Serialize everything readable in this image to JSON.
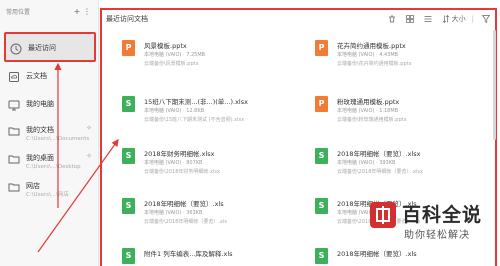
{
  "sidebar": {
    "header_title": "常用位置",
    "add_label": "+",
    "more_label": "⋮",
    "items": [
      {
        "label": "最近访问",
        "sub": ""
      },
      {
        "label": "云文档",
        "sub": ""
      },
      {
        "label": "我的电脑",
        "sub": ""
      },
      {
        "label": "我的文档",
        "sub": "C:\\Users\\...\\Documents"
      },
      {
        "label": "我的桌面",
        "sub": "C:\\Users\\...\\Desktop"
      },
      {
        "label": "网店",
        "sub": "C:\\Users\\...\\网店"
      }
    ]
  },
  "main": {
    "title": "最近访问文档",
    "sort_label": "大小",
    "filter_label": "筛选",
    "files": [
      {
        "name": "风景模板.pptx",
        "meta": "本地电脑 (VAIO)  ·  7.25MB",
        "path": "云端备份\\风景模板.pptx",
        "type": "ppt"
      },
      {
        "name": "花卉简约通用模板.pptx",
        "meta": "本地电脑 (VAIO)  ·  4.43MB",
        "path": "云端备份\\花卉简约通用模板.pptx",
        "type": "ppt"
      },
      {
        "name": "15班八下期末测...(非...)(单...).xlsx",
        "meta": "本地电脑 (VAIO)  ·  12.8KB",
        "path": "云端备份\\15班八下期末测试 (不含音频).xlsx",
        "type": "xls"
      },
      {
        "name": "粉玫瑰通用模板.pptx",
        "meta": "本地电脑 (VAIO)  ·  1.18MB",
        "path": "云端备份\\粉玫瑰通用模板.pptx",
        "type": "ppt"
      },
      {
        "name": "2018年财务明细帐.xlsx",
        "meta": "本地电脑 (VAIO)  ·  807KB",
        "path": "云端备份\\2018年财务明细帐.xlsx",
        "type": "xls"
      },
      {
        "name": "2018年明细帐（要览）.xlsx",
        "meta": "本地电脑 (VAIO)  ·  393KB",
        "path": "云端备份\\2018年明细帐（要览）.xlsx",
        "type": "xls"
      },
      {
        "name": "2018年明细帐（要览）.xls",
        "meta": "本地电脑 (VAIO)  ·  363KB",
        "path": "云端备份\\2018年明细帐（要览）.xls",
        "type": "xls"
      },
      {
        "name": "2018年明细帐（要览）.xls",
        "meta": "本地电脑 (VAIO)  ·  362KB",
        "path": "云端备份\\2018年明细帐（要览）.xls",
        "type": "xls"
      },
      {
        "name": "附件1 列车编表...库及解释.xls",
        "meta": "",
        "path": "",
        "type": "xls"
      },
      {
        "name": "2018年明细帐（要览）.xls",
        "meta": "",
        "path": "",
        "type": "xls"
      }
    ]
  },
  "watermark": {
    "title": "百科全说",
    "subtitle": "助你轻松解决"
  },
  "colors": {
    "highlight": "#e53935",
    "ppt": "#f27b35",
    "xls": "#3eaf5a",
    "watermark_red": "#d32f2f"
  }
}
